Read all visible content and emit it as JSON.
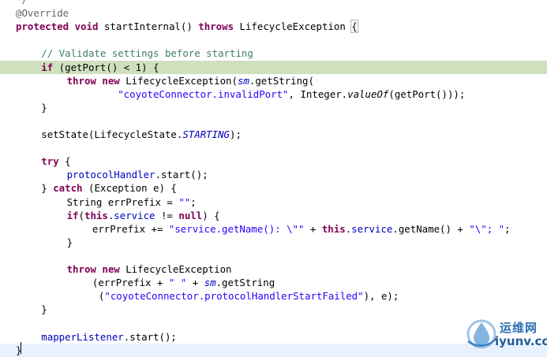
{
  "editor": {
    "highlight_color": "#cfe0bd",
    "caret_line_color": "#e8f2fe",
    "colors": {
      "keyword": "#7f0055",
      "comment": "#3f7f5f",
      "string": "#2a00ff",
      "field": "#0000c0",
      "annotation": "#646464"
    },
    "lines": [
      {
        "indent": 0,
        "tokens": [
          {
            "c": "cm",
            "t": "*/"
          }
        ]
      },
      {
        "indent": 0,
        "tokens": [
          {
            "c": "ann",
            "t": "@Override"
          }
        ]
      },
      {
        "indent": 0,
        "tokens": [
          {
            "c": "kw",
            "t": "protected"
          },
          {
            "t": " "
          },
          {
            "c": "kw",
            "t": "void"
          },
          {
            "t": " startInternal() "
          },
          {
            "c": "kw",
            "t": "throws"
          },
          {
            "t": " LifecycleException "
          },
          {
            "c": "brace-box",
            "t": "{"
          }
        ]
      },
      {
        "indent": 0,
        "tokens": []
      },
      {
        "indent": 1,
        "tokens": [
          {
            "c": "cm",
            "t": "// Validate settings before starting"
          }
        ]
      },
      {
        "indent": 1,
        "highlight": true,
        "tokens": [
          {
            "c": "kw",
            "t": "if"
          },
          {
            "t": " (getPort() < 1) {"
          }
        ]
      },
      {
        "indent": 2,
        "tokens": [
          {
            "c": "kw",
            "t": "throw"
          },
          {
            "t": " "
          },
          {
            "c": "kw",
            "t": "new"
          },
          {
            "t": " LifecycleException("
          },
          {
            "c": "stat-field",
            "t": "sm"
          },
          {
            "t": ".getString("
          }
        ]
      },
      {
        "indent": 4,
        "tokens": [
          {
            "c": "str",
            "t": "\"coyoteConnector.invalidPort\""
          },
          {
            "t": ", Integer."
          },
          {
            "c": "ital",
            "t": "valueOf"
          },
          {
            "t": "(getPort()));"
          }
        ]
      },
      {
        "indent": 1,
        "tokens": [
          {
            "t": "}"
          }
        ]
      },
      {
        "indent": 0,
        "tokens": []
      },
      {
        "indent": 1,
        "tokens": [
          {
            "t": "setState(LifecycleState."
          },
          {
            "c": "stat-field",
            "t": "STARTING"
          },
          {
            "t": ");"
          }
        ]
      },
      {
        "indent": 0,
        "tokens": []
      },
      {
        "indent": 1,
        "tokens": [
          {
            "c": "kw",
            "t": "try"
          },
          {
            "t": " {"
          }
        ]
      },
      {
        "indent": 2,
        "tokens": [
          {
            "c": "fld",
            "t": "protocolHandler"
          },
          {
            "t": ".start();"
          }
        ]
      },
      {
        "indent": 1,
        "tokens": [
          {
            "t": "} "
          },
          {
            "c": "kw",
            "t": "catch"
          },
          {
            "t": " (Exception e) {"
          }
        ]
      },
      {
        "indent": 2,
        "tokens": [
          {
            "t": "String errPrefix = "
          },
          {
            "c": "str",
            "t": "\"\""
          },
          {
            "t": ";"
          }
        ]
      },
      {
        "indent": 2,
        "tokens": [
          {
            "c": "kw",
            "t": "if"
          },
          {
            "t": "("
          },
          {
            "c": "kw",
            "t": "this"
          },
          {
            "t": "."
          },
          {
            "c": "fld",
            "t": "service"
          },
          {
            "t": " != "
          },
          {
            "c": "kw",
            "t": "null"
          },
          {
            "t": ") {"
          }
        ]
      },
      {
        "indent": 3,
        "tokens": [
          {
            "t": "errPrefix += "
          },
          {
            "c": "str",
            "t": "\"service.getName(): \\\"\""
          },
          {
            "t": " + "
          },
          {
            "c": "kw",
            "t": "this"
          },
          {
            "t": "."
          },
          {
            "c": "fld",
            "t": "service"
          },
          {
            "t": ".getName() + "
          },
          {
            "c": "str",
            "t": "\"\\\"; \""
          },
          {
            "t": ";"
          }
        ]
      },
      {
        "indent": 2,
        "tokens": [
          {
            "t": "}"
          }
        ]
      },
      {
        "indent": 0,
        "tokens": []
      },
      {
        "indent": 2,
        "tokens": [
          {
            "c": "kw",
            "t": "throw"
          },
          {
            "t": " "
          },
          {
            "c": "kw",
            "t": "new"
          },
          {
            "t": " LifecycleException"
          }
        ]
      },
      {
        "indent": 3,
        "tokens": [
          {
            "t": "(errPrefix + "
          },
          {
            "c": "str",
            "t": "\" \""
          },
          {
            "t": " + "
          },
          {
            "c": "stat-field",
            "t": "sm"
          },
          {
            "t": ".getString"
          }
        ]
      },
      {
        "indent": 3,
        "extra": 1,
        "tokens": [
          {
            "t": "("
          },
          {
            "c": "str",
            "t": "\"coyoteConnector.protocolHandlerStartFailed\""
          },
          {
            "t": "), e);"
          }
        ]
      },
      {
        "indent": 1,
        "tokens": [
          {
            "t": "}"
          }
        ]
      },
      {
        "indent": 0,
        "tokens": []
      },
      {
        "indent": 1,
        "tokens": [
          {
            "c": "fld",
            "t": "mapperListener"
          },
          {
            "t": ".start();"
          }
        ]
      },
      {
        "indent": 0,
        "caret": true,
        "tokens": [
          {
            "t": "}"
          }
        ]
      }
    ]
  },
  "watermark": {
    "text_cn": "运维网",
    "url": "iyunv.com",
    "icon": "water-drop-logo-icon"
  }
}
